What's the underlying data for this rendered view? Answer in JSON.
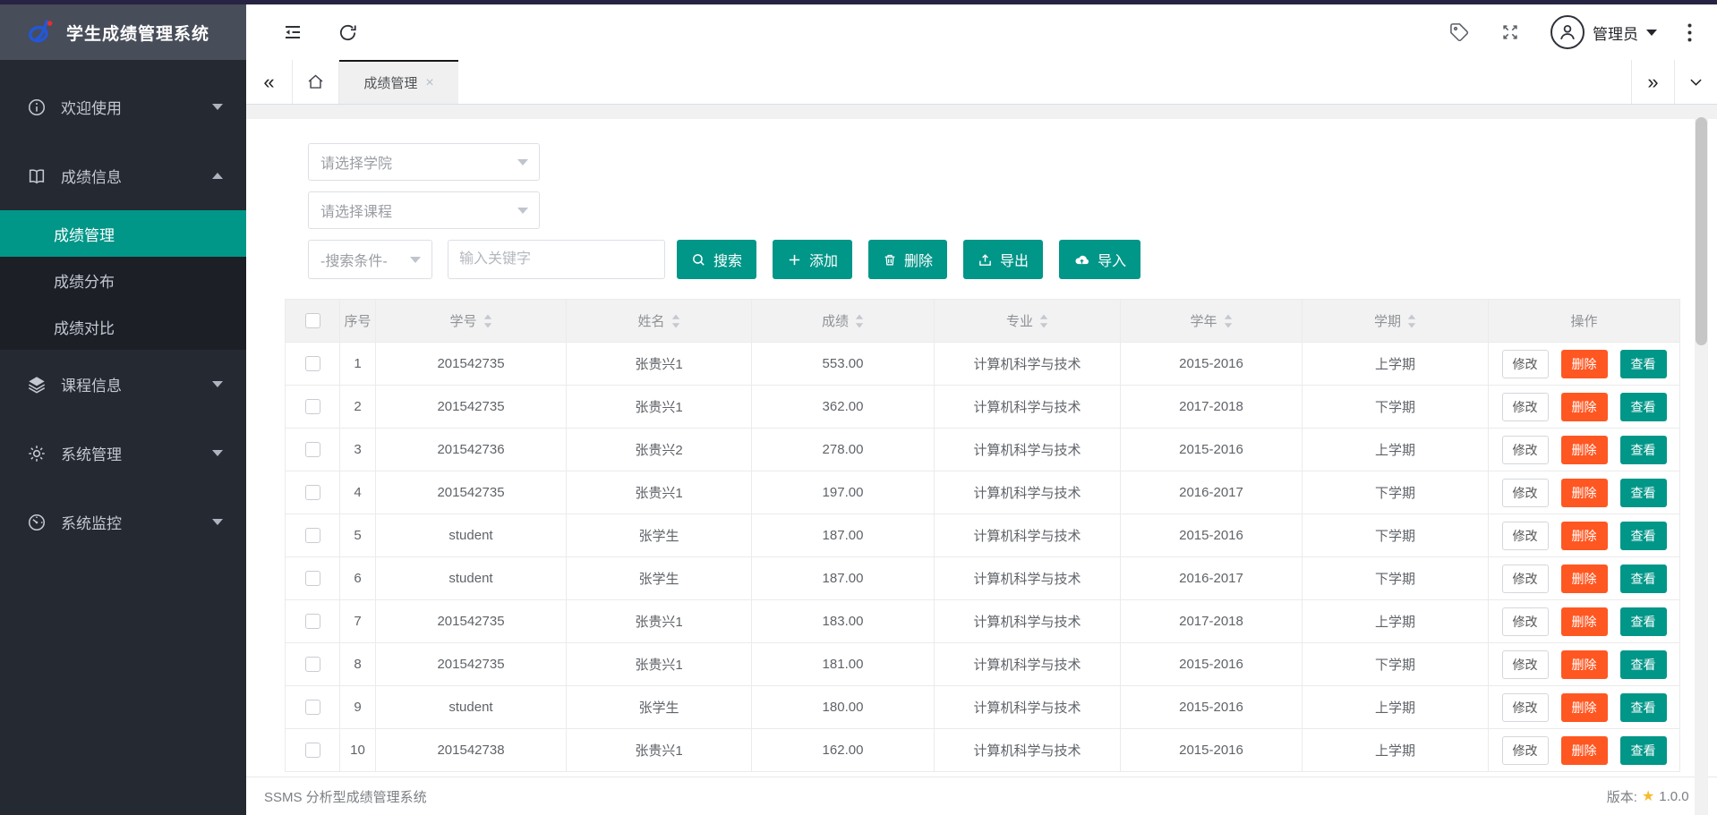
{
  "app": {
    "title": "学生成绩管理系统"
  },
  "colors": {
    "accent": "#009688",
    "danger": "#ff5722",
    "star": "#f7ba2a",
    "sidebar": "#252932",
    "sidebar_header": "#474d59",
    "top_strip": "#272343"
  },
  "header": {
    "user_name": "管理员"
  },
  "tabs": {
    "active": "成绩管理"
  },
  "sidebar": {
    "items": [
      {
        "label": "欢迎使用",
        "icon": "info-icon",
        "expanded": false
      },
      {
        "label": "成绩信息",
        "icon": "book-icon",
        "expanded": true,
        "children": [
          {
            "label": "成绩管理",
            "active": true
          },
          {
            "label": "成绩分布",
            "active": false
          },
          {
            "label": "成绩对比",
            "active": false
          }
        ]
      },
      {
        "label": "课程信息",
        "icon": "layers-icon",
        "expanded": false
      },
      {
        "label": "系统管理",
        "icon": "gear-icon",
        "expanded": false
      },
      {
        "label": "系统监控",
        "icon": "monitor-icon",
        "expanded": false
      }
    ]
  },
  "filters": {
    "college_placeholder": "请选择学院",
    "course_placeholder": "请选择课程",
    "condition_placeholder": "-搜索条件-",
    "keyword_placeholder": "输入关键字"
  },
  "toolbar": {
    "search_label": "搜索",
    "add_label": "添加",
    "delete_label": "删除",
    "export_label": "导出",
    "import_label": "导入"
  },
  "table": {
    "columns": [
      {
        "label": "序号",
        "sortable": false
      },
      {
        "label": "学号",
        "sortable": true
      },
      {
        "label": "姓名",
        "sortable": true
      },
      {
        "label": "成绩",
        "sortable": true
      },
      {
        "label": "专业",
        "sortable": true
      },
      {
        "label": "学年",
        "sortable": true
      },
      {
        "label": "学期",
        "sortable": true
      },
      {
        "label": "操作",
        "sortable": false
      }
    ],
    "row_actions": {
      "edit": "修改",
      "delete": "删除",
      "view": "查看"
    },
    "rows": [
      {
        "index": 1,
        "student_id": "201542735",
        "name": "张贵兴1",
        "score": "553.00",
        "major": "计算机科学与技术",
        "year": "2015-2016",
        "term": "上学期"
      },
      {
        "index": 2,
        "student_id": "201542735",
        "name": "张贵兴1",
        "score": "362.00",
        "major": "计算机科学与技术",
        "year": "2017-2018",
        "term": "下学期"
      },
      {
        "index": 3,
        "student_id": "201542736",
        "name": "张贵兴2",
        "score": "278.00",
        "major": "计算机科学与技术",
        "year": "2015-2016",
        "term": "上学期"
      },
      {
        "index": 4,
        "student_id": "201542735",
        "name": "张贵兴1",
        "score": "197.00",
        "major": "计算机科学与技术",
        "year": "2016-2017",
        "term": "下学期"
      },
      {
        "index": 5,
        "student_id": "student",
        "name": "张学生",
        "score": "187.00",
        "major": "计算机科学与技术",
        "year": "2015-2016",
        "term": "下学期"
      },
      {
        "index": 6,
        "student_id": "student",
        "name": "张学生",
        "score": "187.00",
        "major": "计算机科学与技术",
        "year": "2016-2017",
        "term": "下学期"
      },
      {
        "index": 7,
        "student_id": "201542735",
        "name": "张贵兴1",
        "score": "183.00",
        "major": "计算机科学与技术",
        "year": "2017-2018",
        "term": "上学期"
      },
      {
        "index": 8,
        "student_id": "201542735",
        "name": "张贵兴1",
        "score": "181.00",
        "major": "计算机科学与技术",
        "year": "2015-2016",
        "term": "下学期"
      },
      {
        "index": 9,
        "student_id": "student",
        "name": "张学生",
        "score": "180.00",
        "major": "计算机科学与技术",
        "year": "2015-2016",
        "term": "上学期"
      },
      {
        "index": 10,
        "student_id": "201542738",
        "name": "张贵兴1",
        "score": "162.00",
        "major": "计算机科学与技术",
        "year": "2015-2016",
        "term": "上学期"
      }
    ]
  },
  "footer": {
    "left_text": "SSMS 分析型成绩管理系统",
    "version_label": "版本:",
    "version": "1.0.0"
  }
}
